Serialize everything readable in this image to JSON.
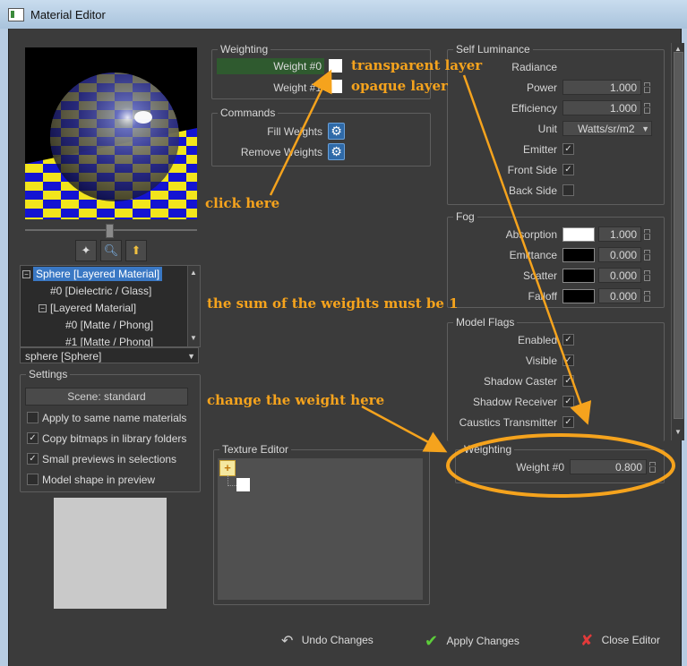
{
  "window": {
    "title": "Material Editor"
  },
  "preview_toolbar": {
    "icons": [
      "wand-icon",
      "zoom-icon",
      "load-icon"
    ]
  },
  "tree": {
    "items": [
      {
        "label": "Sphere [Layered Material]",
        "selected": true
      },
      {
        "label": "#0 [Dielectric / Glass]"
      },
      {
        "label": "[Layered Material]"
      },
      {
        "label": "#0 [Matte / Phong]"
      },
      {
        "label": "#1 [Matte / Phong]"
      }
    ]
  },
  "object_select": {
    "value": "sphere [Sphere]"
  },
  "settings": {
    "title": "Settings",
    "scene_button": "Scene: standard",
    "options": [
      {
        "label": "Apply to same name materials",
        "checked": false
      },
      {
        "label": "Copy bitmaps in library folders",
        "checked": true
      },
      {
        "label": "Small previews in selections",
        "checked": true
      },
      {
        "label": "Model shape in preview",
        "checked": false
      }
    ]
  },
  "weighting": {
    "title": "Weighting",
    "rows": [
      "Weight #0",
      "Weight #1"
    ]
  },
  "commands": {
    "title": "Commands",
    "items": [
      "Fill Weights",
      "Remove Weights"
    ]
  },
  "texture_editor": {
    "title": "Texture Editor"
  },
  "self_luminance": {
    "title": "Self Luminance",
    "radiance_label": "Radiance",
    "power_label": "Power",
    "power_value": "1.000",
    "efficiency_label": "Efficiency",
    "efficiency_value": "1.000",
    "unit_label": "Unit",
    "unit_value": "Watts/sr/m2",
    "emitter_label": "Emitter",
    "front_side_label": "Front Side",
    "back_side_label": "Back Side"
  },
  "fog": {
    "title": "Fog",
    "rows": [
      {
        "label": "Absorption",
        "value": "1.000",
        "color": "#ffffff"
      },
      {
        "label": "Emittance",
        "value": "0.000",
        "color": "#000000"
      },
      {
        "label": "Scatter",
        "value": "0.000",
        "color": "#000000"
      },
      {
        "label": "Falloff",
        "value": "0.000",
        "color": "#000000"
      }
    ]
  },
  "model_flags": {
    "title": "Model Flags",
    "items": [
      "Enabled",
      "Visible",
      "Shadow Caster",
      "Shadow Receiver",
      "Caustics Transmitter"
    ]
  },
  "layer_weighting": {
    "title": "Weighting",
    "label": "Weight #0",
    "value": "0.800"
  },
  "bottom_buttons": {
    "undo": "Undo Changes",
    "apply": "Apply Changes",
    "close": "Close Editor"
  },
  "annotations": {
    "transparent": "transparent layer",
    "opaque": "opaque layer",
    "click": "click here",
    "sum": "the sum of the weights must be 1",
    "change": "change the weight here"
  },
  "colors": {
    "accent": "#f5a31d",
    "selection": "#3a78c4",
    "weight_highlight": "#2f5a2f"
  }
}
